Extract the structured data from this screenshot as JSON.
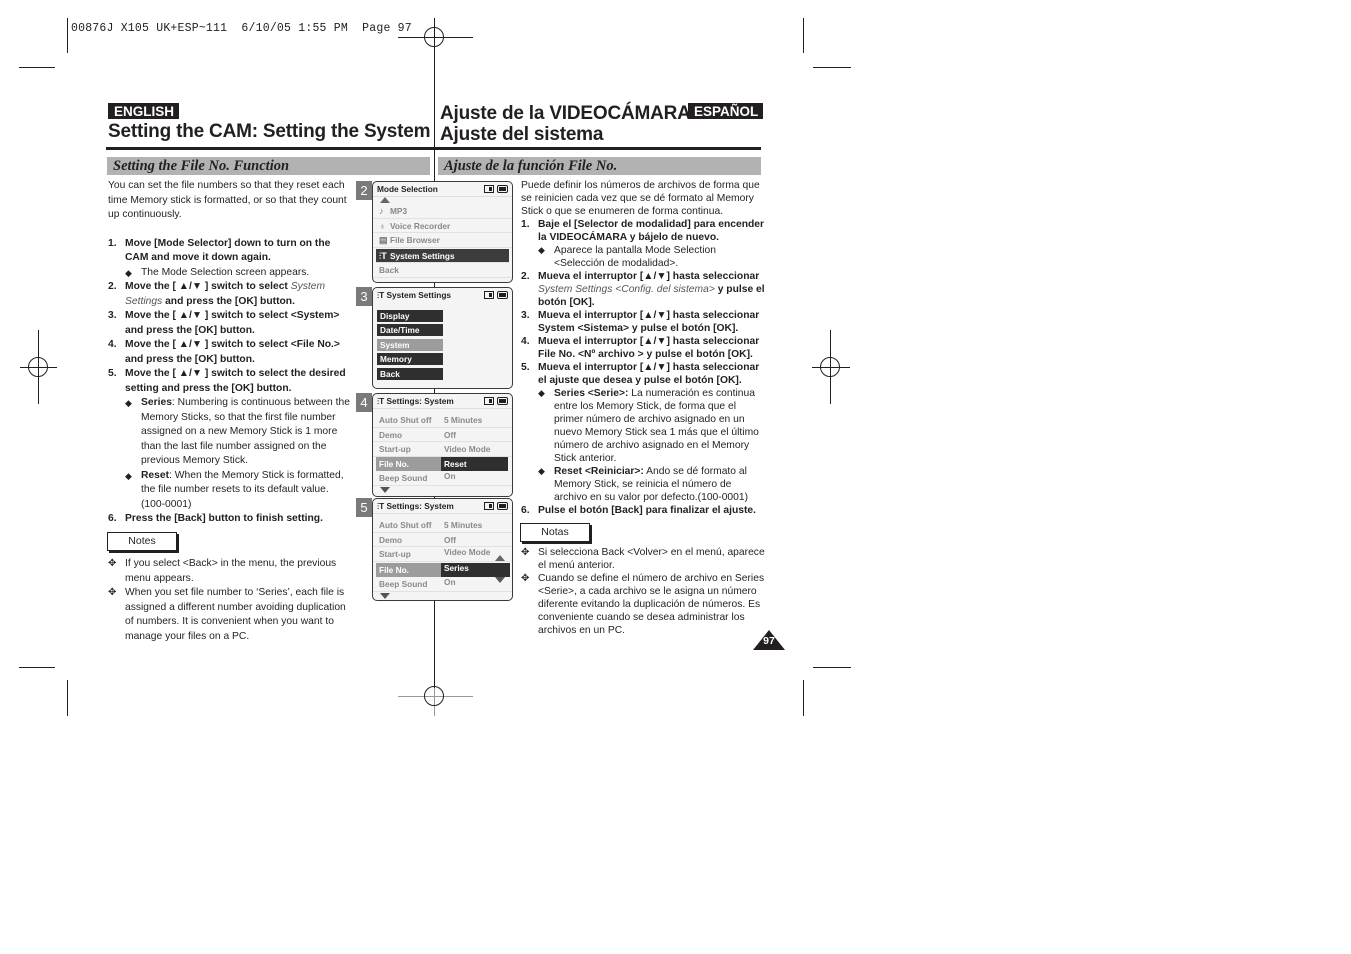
{
  "slug": "00876J X105 UK+ESP~111  6/10/05 1:55 PM  Page 97",
  "english": {
    "badge": "ENGLISH",
    "title": "Setting the CAM: Setting the System",
    "section": "Setting the File No. Function",
    "intro": "You can set the file numbers so that they reset each time Memory stick is formatted, or so that they count up continuously.",
    "steps": [
      {
        "num": "1.",
        "text": "Move [Mode Selector] down to turn on the CAM and move it down again.",
        "subs": [
          {
            "text": "The Mode Selection screen appears."
          }
        ]
      },
      {
        "num": "2.",
        "pre": "Move the [ ▲/▼ ] switch to select ",
        "ital": "System Settings",
        "post": " and press the [OK] button."
      },
      {
        "num": "3.",
        "text": "Move the [ ▲/▼ ] switch to select <System> and press the [OK] button."
      },
      {
        "num": "4.",
        "text": "Move the [ ▲/▼ ] switch to select <File No.> and press the [OK] button."
      },
      {
        "num": "5.",
        "text": "Move the [ ▲/▼ ] switch to select the desired setting and press the [OK] button.",
        "subs": [
          {
            "bold": "Series",
            "text": ": Numbering is continuous between the Memory Sticks, so that the first file number assigned on a new Memory Stick is 1 more than the last file number assigned on the previous Memory Stick."
          },
          {
            "bold": "Reset",
            "text": ": When the Memory Stick is formatted, the file number resets to its default value. (100-0001)"
          }
        ]
      },
      {
        "num": "6.",
        "text": "Press the [Back] button to finish setting."
      }
    ],
    "notes_label": "Notes",
    "notes": [
      "If you select <Back> in the menu, the previous menu appears.",
      "When you set file number to ‘Series’, each file is assigned a different number avoiding duplication of numbers. It is convenient when you want to manage your files on a PC."
    ]
  },
  "spanish": {
    "badge": "ESPAÑOL",
    "title_line1": "Ajuste de la VIDEOCÁMARA:",
    "title_line2": "Ajuste del sistema",
    "section": "Ajuste de la función File No.",
    "intro": "Puede definir los números de archivos de forma que se reinicien cada vez que se dé formato al Memory Stick o que se enumeren de forma continua.",
    "steps": [
      {
        "num": "1.",
        "text": "Baje el [Selector de modalidad] para encender la VIDEOCÁMARA y bájelo de nuevo.",
        "subs": [
          {
            "text": "Aparece la pantalla Mode Selection <Selección de modalidad>."
          }
        ]
      },
      {
        "num": "2.",
        "pre": "Mueva el interruptor [▲/▼] hasta seleccionar ",
        "ital": "System Settings <Config. del sistema>",
        "post": " y pulse el botón [OK]."
      },
      {
        "num": "3.",
        "text": "Mueva el interruptor [▲/▼] hasta seleccionar System <Sistema> y pulse el botón [OK]."
      },
      {
        "num": "4.",
        "text": "Mueva el interruptor [▲/▼] hasta seleccionar File No. <Nº archivo > y pulse el botón [OK]."
      },
      {
        "num": "5.",
        "text": "Mueva el interruptor [▲/▼] hasta seleccionar el ajuste que desea y pulse el botón [OK].",
        "subs": [
          {
            "bold": "Series <Serie>:",
            "text": " La numeración es continua entre los Memory Stick, de forma que el primer número de archivo asignado en un nuevo Memory Stick sea 1 más que el último número de archivo asignado en el Memory Stick anterior."
          },
          {
            "bold": "Reset <Reiniciar>:",
            "text": " Ando se dé formato al Memory Stick, se reinicia el número de archivo en su valor por defecto.(100-0001)"
          }
        ]
      },
      {
        "num": "6.",
        "text": "Pulse el botón [Back] para finalizar el ajuste."
      }
    ],
    "notes_label": "Notas",
    "notes": [
      "Si selecciona Back <Volver> en el menú, aparece el menú anterior.",
      "Cuando se define el número de archivo en Series <Serie>, a cada archivo se le asigna un número diferente evitando la duplicación de números. Es conveniente cuando se desea administrar los archivos en un PC."
    ]
  },
  "screens": {
    "s2": {
      "num": "2",
      "title": "Mode Selection",
      "items": [
        {
          "icon": "music-note-icon",
          "glyph": "♪",
          "label": "MP3"
        },
        {
          "icon": "microphone-icon",
          "glyph": "🎙",
          "label": "Voice Recorder"
        },
        {
          "icon": "file-browser-icon",
          "glyph": "▤",
          "label": "File Browser"
        },
        {
          "icon": "settings-icon",
          "glyph": "⚙",
          "label": "System Settings",
          "selected": true
        },
        {
          "label": "Back"
        }
      ]
    },
    "s3": {
      "num": "3",
      "title": "System Settings",
      "items": [
        "Display",
        "Date/Time",
        "System",
        "Memory",
        "Back"
      ],
      "selected": "System"
    },
    "s4": {
      "num": "4",
      "title": "Settings: System",
      "rows": [
        {
          "k": "Auto Shut off",
          "v": "5 Minutes"
        },
        {
          "k": "Demo",
          "v": "Off"
        },
        {
          "k": "Start-up",
          "v": "Video Mode"
        },
        {
          "k": "File No.",
          "v": "Reset",
          "selected": true
        },
        {
          "k": "Beep Sound",
          "v": "On"
        }
      ]
    },
    "s5": {
      "num": "5",
      "title": "Settings: System",
      "rows": [
        {
          "k": "Auto Shut off",
          "v": "5 Minutes"
        },
        {
          "k": "Demo",
          "v": "Off"
        },
        {
          "k": "Start-up",
          "v": "Video Mode"
        },
        {
          "k": "File No.",
          "v": "Series",
          "selected": true
        },
        {
          "k": "Beep Sound",
          "v": "On"
        }
      ]
    }
  },
  "page_number": "97"
}
